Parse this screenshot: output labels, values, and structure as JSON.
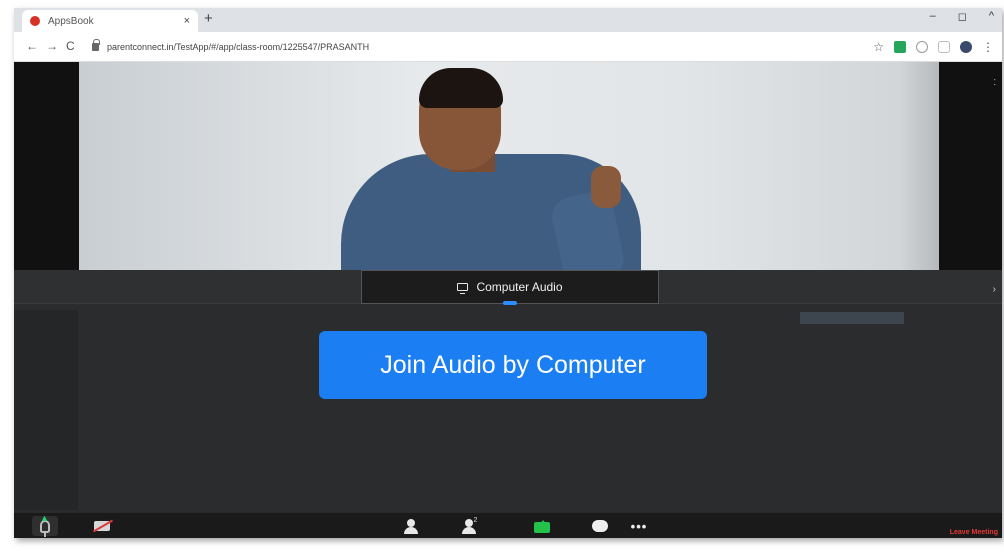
{
  "browser": {
    "tab_title": "AppsBook",
    "tab_close": "×",
    "new_tab": "+",
    "window_controls": [
      "–",
      "◻",
      "^"
    ],
    "url": "parentconnect.in/TestApp/#/app/class-room/1225547/PRASANTH",
    "nav": {
      "back": "←",
      "forward": "→",
      "reload": "C"
    },
    "star": "☆",
    "menu": "⋮"
  },
  "meeting": {
    "audio_tab_label": "Computer Audio",
    "join_button_label": "Join Audio by Computer",
    "participants_count": "2",
    "more_label": "•••",
    "leave_label": "Leave Meeting",
    "expand_icon": "›"
  },
  "colors": {
    "join_button": "#1c7ef3",
    "leave_text": "#e53935",
    "share_green": "#23c14a"
  }
}
